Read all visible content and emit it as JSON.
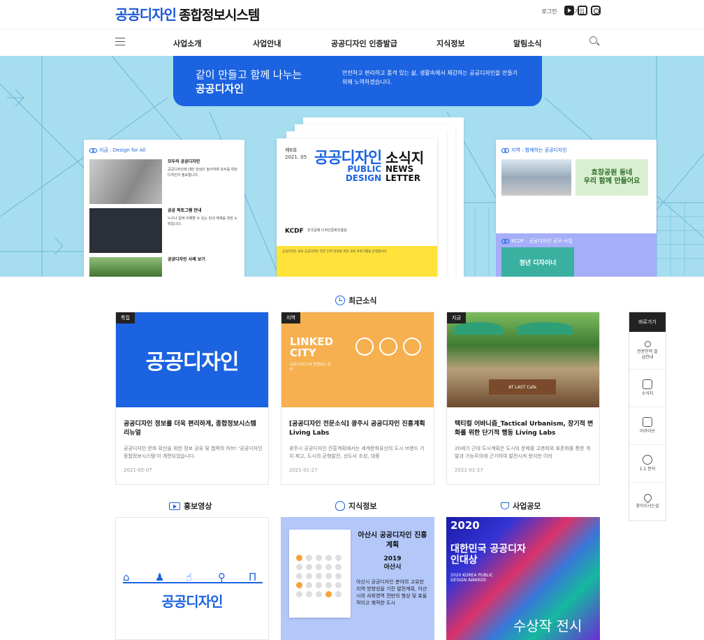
{
  "header": {
    "logo_mark": "공공디자인",
    "logo_text": "종합정보시스템",
    "login": "로그인",
    "signup": "회원가입",
    "sns": [
      "youtube-icon",
      "blog-icon",
      "instagram-icon"
    ]
  },
  "gnb": {
    "items": [
      "사업소개",
      "사업안내",
      "공공디자인 인증발급",
      "지식정보",
      "알림소식"
    ]
  },
  "hero": {
    "banner_line1": "같이 만들고 함께 나누는",
    "banner_line2": "공공디자인",
    "banner_desc": "안전하고 편리하고 품격 있는 삶, 생활속에서 체감하는 공공디자인을 만들기 위해 노력하겠습니다.",
    "left_panel_title": "지금 : Design for All",
    "left_items": [
      {
        "title": "모두의 공공디자인",
        "text": "공공디자인에 대한 관심이 높아지며 모두를 위한 디자인이 필요합니다."
      },
      {
        "title": "공공 픽토그램 안내",
        "text": "누구나 쉽게 이해할 수 있는 안내 체계를 위한 노력입니다."
      },
      {
        "title": "공공디자인 사례 보기",
        "text": ""
      }
    ],
    "newsletter": {
      "issue": "제6호",
      "date": "2021. 05",
      "logo": "공공디자인",
      "title_ko": "소식지",
      "public_design": "PUBLIC DESIGN",
      "newsletter": "NEWS LETTER",
      "publisher": "KCDF",
      "publisher_name": "한국공예·디자인문화진흥원",
      "bottom_text": "공공디자인 교육 공공디자인 전문 인력 양성을 위한 교육 프로그램을 운영합니다."
    },
    "right_panel_title": "지역 : 함께하는 공공디자인",
    "right_img_text1": "효창공원 동네",
    "right_img_text2": "우리 함께 만들어요",
    "right_panel2_title": "KCDF : 공공디자인 공모·사업",
    "right_panel2_img": "청년 디자이너"
  },
  "sections": {
    "news_title": "최근소식",
    "video_title": "홍보영상",
    "knowledge_title": "지식정보",
    "contest_title": "사업공모"
  },
  "news": [
    {
      "tag": "특집",
      "image_text": "공공디자인",
      "title": "공공디자인 정보를 더욱 편리하게, 종합정보시스템 리뉴얼",
      "desc": "공공디자인 문화 확산을 위한 정보 공유 및 협력의 허브! '공공디자인 종합정보시스템'이 개편되었습니다.",
      "date": "2021-05-07"
    },
    {
      "tag": "지역",
      "image_text": "LINKED CITY",
      "image_sub": "공공디자인으로 연결되는 광주",
      "title": "[공공디자인 전문소식] 광주시 공공디자인 진흥계획 Living Labs",
      "desc": "광주시 공공디자인 진흥계획에서는 세계문화유산의 도시 브랜드 가치 제고, 도시의 균형발전, 선도사 조성, 대중",
      "date": "2021-01-27"
    },
    {
      "tag": "지금",
      "image_text": "AT LAST Cafe",
      "title": "택티컬 어바니즘_Tactical Urbanism, 장기적 변화를 위한 단기적 행동 Living Labs",
      "desc": "20세기 근대 도시계획은 도시의 문제를 고층화와 표준화를 통한 개발과 기능주의에 근거하여 발전시켜 왔지만 이러",
      "date": "2021-01-27"
    }
  ],
  "quick": {
    "head": "바로가기",
    "items": [
      {
        "icon": "person-icon",
        "label": "전문인력 발급안내"
      },
      {
        "icon": "newsletter-icon",
        "label": "소식지"
      },
      {
        "icon": "archive-icon",
        "label": "아카이브"
      },
      {
        "icon": "chat-icon",
        "label": "1:1 문의"
      },
      {
        "icon": "location-pin-icon",
        "label": "찾아오시는길"
      }
    ]
  },
  "video": {
    "logo": "공공디자인"
  },
  "knowledge": {
    "title": "아산시 공공디자인 진흥계획",
    "year": "2019",
    "city": "아산시",
    "desc": "아산시 공공디자인 분야의 고유한 지역 방향성을 기진 발전계획, 아산시의 사회영역 전반의 형상 및 효율적이고 쾌적한 도시"
  },
  "contest": {
    "year": "2020",
    "title": "대한민국 공공디자인대상",
    "sub": "2020 KOREA PUBLIC DESIGN AWARDS",
    "winners": "수상작 전시"
  },
  "colors": {
    "brand": "#1b63e0",
    "hero_bg": "#a6def0",
    "yellow": "#ffe23a",
    "orange": "#f6b04f"
  }
}
